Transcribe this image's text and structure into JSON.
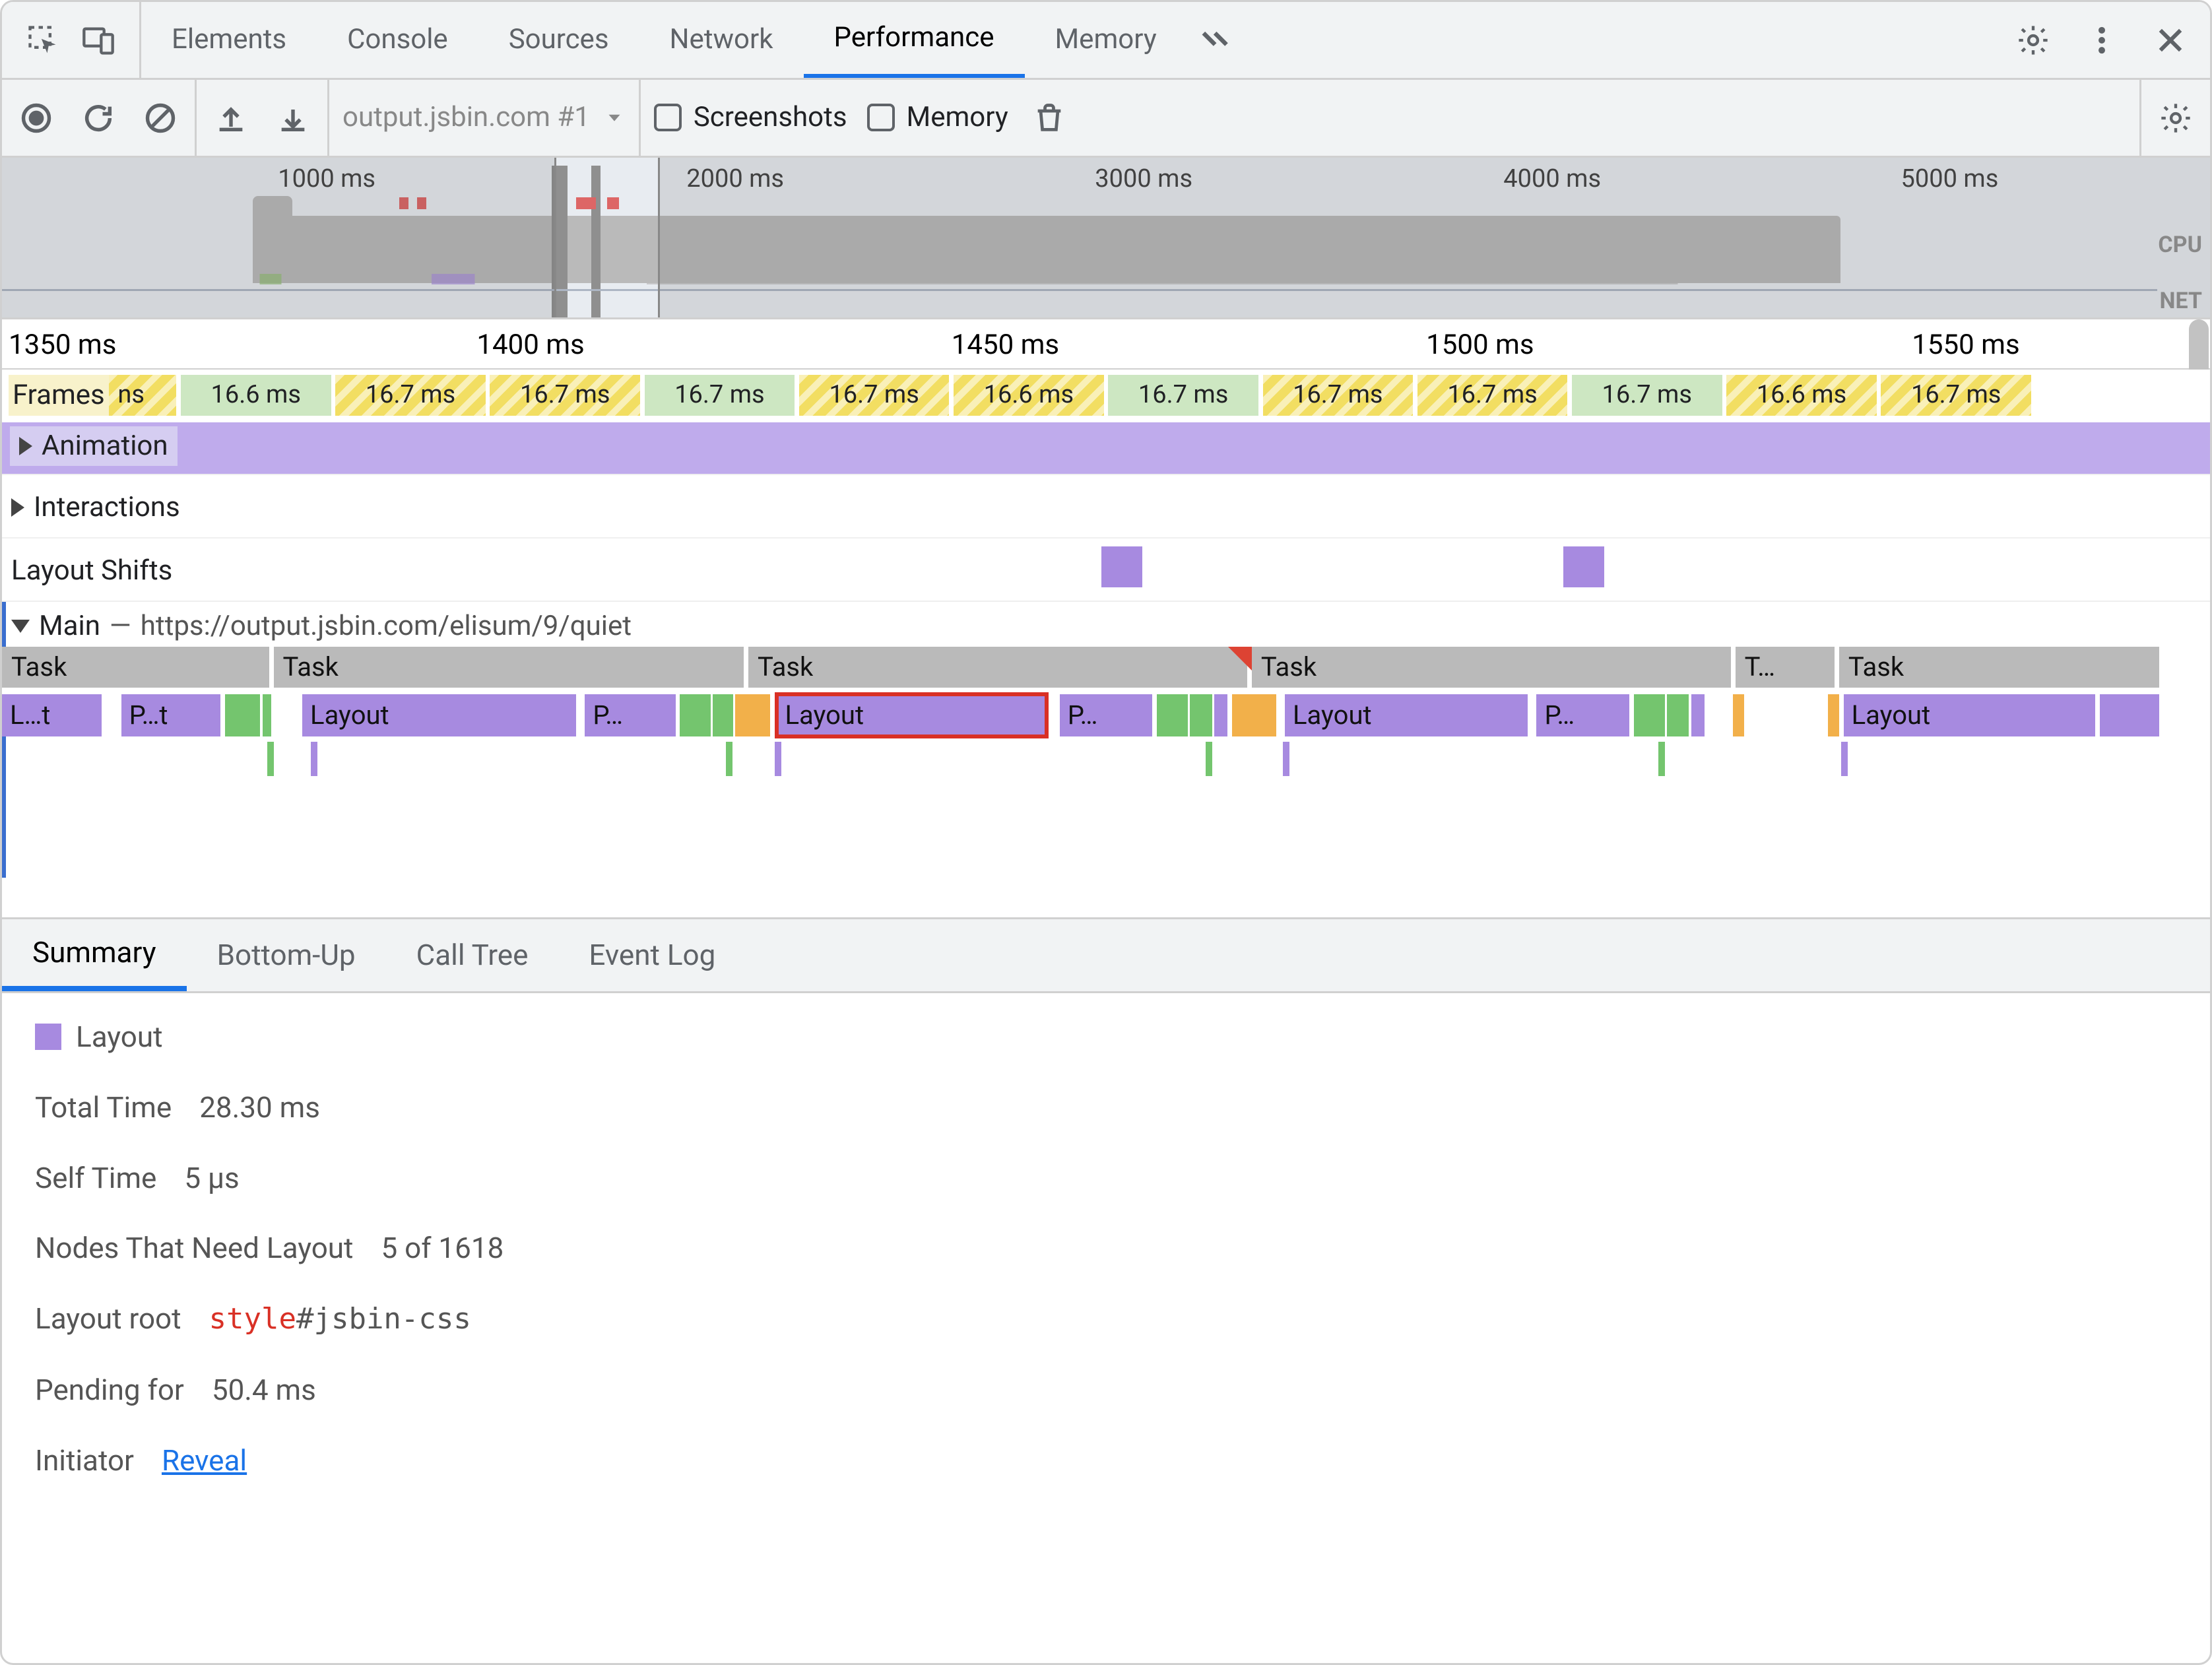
{
  "tabs": {
    "items": [
      "Elements",
      "Console",
      "Sources",
      "Network",
      "Performance",
      "Memory"
    ],
    "active": "Performance"
  },
  "toolbar": {
    "profile_name": "output.jsbin.com #1",
    "screenshots_label": "Screenshots",
    "memory_label": "Memory"
  },
  "overview": {
    "ticks": [
      "1000 ms",
      "2000 ms",
      "3000 ms",
      "4000 ms",
      "5000 ms"
    ],
    "cpu_label": "CPU",
    "net_label": "NET",
    "viewport_start_pct": 25.0,
    "viewport_end_pct": 29.8
  },
  "ruler_ticks": [
    "1350 ms",
    "1400 ms",
    "1450 ms",
    "1500 ms",
    "1550 ms"
  ],
  "tracks": {
    "frames_label": "Frames",
    "frames": [
      {
        "label": "ns",
        "type": "y",
        "left": 3.8,
        "width": 4.1
      },
      {
        "label": "16.6 ms",
        "type": "g",
        "left": 8.1,
        "width": 6.8
      },
      {
        "label": "16.7 ms",
        "type": "y",
        "left": 15.1,
        "width": 6.8
      },
      {
        "label": "16.7 ms",
        "type": "y",
        "left": 22.1,
        "width": 6.8
      },
      {
        "label": "16.7 ms",
        "type": "g",
        "left": 29.1,
        "width": 6.8
      },
      {
        "label": "16.7 ms",
        "type": "y",
        "left": 36.1,
        "width": 6.8
      },
      {
        "label": "16.6 ms",
        "type": "y",
        "left": 43.1,
        "width": 6.8
      },
      {
        "label": "16.7 ms",
        "type": "g",
        "left": 50.1,
        "width": 6.8
      },
      {
        "label": "16.7 ms",
        "type": "y",
        "left": 57.1,
        "width": 6.8
      },
      {
        "label": "16.7 ms",
        "type": "y",
        "left": 64.1,
        "width": 6.8
      },
      {
        "label": "16.7 ms",
        "type": "g",
        "left": 71.1,
        "width": 6.8
      },
      {
        "label": "16.6 ms",
        "type": "y",
        "left": 78.1,
        "width": 6.8
      },
      {
        "label": "16.7 ms",
        "type": "y",
        "left": 85.1,
        "width": 6.8
      }
    ],
    "animation_label": "Animation",
    "interactions_label": "Interactions",
    "layoutshifts_label": "Layout Shifts",
    "layoutshifts_marks": [
      49.8,
      70.7
    ],
    "main_label": "Main",
    "main_sep": "—",
    "main_url": "https://output.jsbin.com/elisum/9/quiet",
    "task_label": "Task",
    "task_short": "T…",
    "layout_label": "Layout",
    "layout_short": "L…t",
    "paint_short": "P…t",
    "p_short": "P…"
  },
  "bottom_tabs": {
    "items": [
      "Summary",
      "Bottom-Up",
      "Call Tree",
      "Event Log"
    ],
    "active": "Summary"
  },
  "summary": {
    "title": "Layout",
    "rows": {
      "total_time": {
        "k": "Total Time",
        "v": "28.30 ms"
      },
      "self_time": {
        "k": "Self Time",
        "v": "5 µs"
      },
      "nodes": {
        "k": "Nodes That Need Layout",
        "v": "5 of 1618"
      },
      "root": {
        "k": "Layout root",
        "el": "style",
        "id": "#jsbin-css"
      },
      "pending": {
        "k": "Pending for",
        "v": "50.4 ms"
      },
      "initiator": {
        "k": "Initiator",
        "link": "Reveal"
      }
    }
  }
}
